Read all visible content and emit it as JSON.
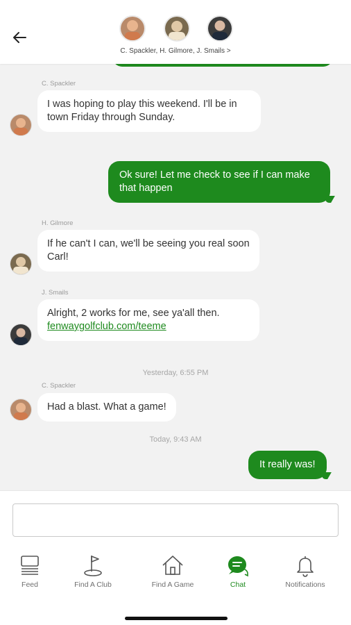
{
  "header": {
    "participants": "C. Spackler, H. Gilmore, J. Smails >"
  },
  "messages": [
    {
      "sender": "C. Spackler",
      "text": "I was hoping to play this weekend. I'll be in town Friday through Sunday."
    },
    {
      "text": "Ok sure! Let me check to see if I can make that happen"
    },
    {
      "sender": "H. Gilmore",
      "text": "If he can't I can, we'll be seeing you real soon Carl!"
    },
    {
      "sender": "J. Smails",
      "text": "Alright, 2 works for me, see ya'all then.",
      "link": "fenwaygolfclub.com/teeme"
    },
    {
      "timestamp": "Yesterday, 6:55 PM"
    },
    {
      "sender": "C. Spackler",
      "text": "Had a blast. What a game!"
    },
    {
      "timestamp": "Today, 9:43 AM"
    },
    {
      "text": "It really was!"
    }
  ],
  "composer": {
    "value": ""
  },
  "nav": {
    "items": [
      {
        "label": "Feed",
        "icon": "feed-icon"
      },
      {
        "label": "Find A Club",
        "icon": "flag-icon"
      },
      {
        "label": "Find A Game",
        "icon": "home-icon"
      },
      {
        "label": "Chat",
        "icon": "chat-icon",
        "active": true
      },
      {
        "label": "Notifications",
        "icon": "bell-icon"
      }
    ]
  },
  "colors": {
    "accent": "#1e8a1e",
    "background": "#f2f2f2"
  }
}
